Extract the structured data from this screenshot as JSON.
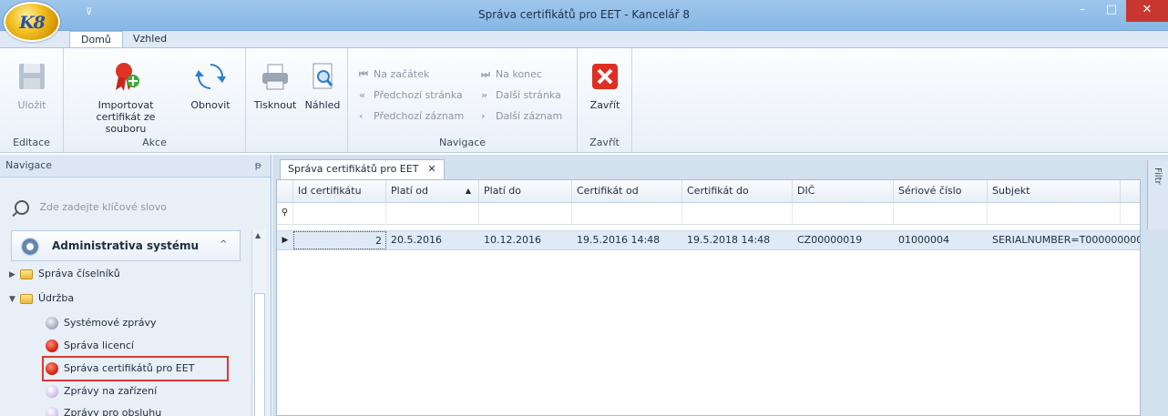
{
  "window": {
    "title": "Správa certifikátů pro EET - Kancelář 8",
    "logo_text": "K8",
    "minimize": "–",
    "maximize": "□",
    "close": "✕"
  },
  "ribbon_tabs": [
    "Domů",
    "Vzhled"
  ],
  "ribbon": {
    "editace": {
      "label": "Editace",
      "save": "Uložit"
    },
    "akce": {
      "label": "Akce",
      "import": "Importovat certifikát ze souboru",
      "refresh": "Obnovit"
    },
    "print": {
      "print": "Tisknout",
      "preview": "Náhled"
    },
    "navigace": {
      "label": "Navigace",
      "first": "Na začátek",
      "prev_page": "Předchozí stránka",
      "prev_record": "Předchozí záznam",
      "last": "Na konec",
      "next_page": "Další stránka",
      "next_record": "Další záznam"
    },
    "zavrit": {
      "label": "Zavřít",
      "close": "Zavřít"
    }
  },
  "nav_panel": {
    "title": "Navigace",
    "pin": "ᵽ",
    "search_placeholder": "Zde zadejte klíčové slovo",
    "group_title": "Administrativa systému",
    "items": [
      {
        "label": "Správa číselníků",
        "level": 0,
        "icon": "folder-icon",
        "expand": "▶"
      },
      {
        "label": "Údržba",
        "level": 0,
        "icon": "folder-icon",
        "expand": "▼"
      },
      {
        "label": "Systémové zprávy",
        "level": 1,
        "icon": "system-messages-icon"
      },
      {
        "label": "Správa licencí",
        "level": 1,
        "icon": "license-ribbon-icon"
      },
      {
        "label": "Správa certifikátů pro EET",
        "level": 1,
        "icon": "certificate-ribbon-icon"
      },
      {
        "label": "Zprávy na zařízení",
        "level": 1,
        "icon": "device-messages-icon"
      },
      {
        "label": "Zprávy pro obsluhu",
        "level": 1,
        "icon": "operator-messages-icon"
      }
    ]
  },
  "document_tab": {
    "title": "Správa certifikátů pro EET",
    "close": "✕"
  },
  "filter_bar_label": "Filtr",
  "grid": {
    "columns": [
      "Id certifikátu",
      "Platí od",
      "Platí do",
      "Certifikát od",
      "Certifikát do",
      "DIČ",
      "Sériové číslo",
      "Subjekt"
    ],
    "sort_indicator": "▲",
    "rows": [
      [
        "2",
        "20.5.2016",
        "10.12.2016",
        "19.5.2016 14:48",
        "19.5.2018 14:48",
        "CZ00000019",
        "01000004",
        "SERIALNUMBER=T000000000"
      ]
    ]
  }
}
